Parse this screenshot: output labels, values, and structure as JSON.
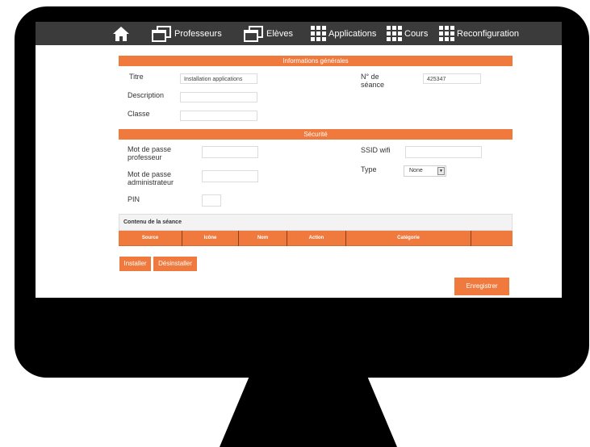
{
  "nav": {
    "professeurs": "Professeurs",
    "eleves": "Elèves",
    "applications": "Applications",
    "cours": "Cours",
    "reconfiguration": "Reconfiguration"
  },
  "sections": {
    "general": "Informations générales",
    "securite": "Sécurité"
  },
  "form": {
    "titre_label": "Titre",
    "titre_value": "Installation applications",
    "description_label": "Description",
    "description_value": "",
    "classe_label": "Classe",
    "classe_value": "",
    "seance_label_1": "N° de",
    "seance_label_2": "séance",
    "seance_value": "425347",
    "mdp_prof_label_1": "Mot de passe",
    "mdp_prof_label_2": "professeur",
    "mdp_admin_label_1": "Mot de passe",
    "mdp_admin_label_2": "administrateur",
    "pin_label": "PIN",
    "ssid_label": "SSID wifi",
    "type_label": "Type",
    "type_value": "None"
  },
  "content": {
    "title": "Contenu de la séance",
    "columns": [
      "Source",
      "Icône",
      "Nom",
      "Action",
      "Catégorie",
      ""
    ]
  },
  "buttons": {
    "installer": "Installer",
    "desinstaller": "Désinstaller",
    "enregistrer": "Enregistrer"
  },
  "colors": {
    "accent": "#f07a3e",
    "navbar": "#3b3b3b"
  }
}
